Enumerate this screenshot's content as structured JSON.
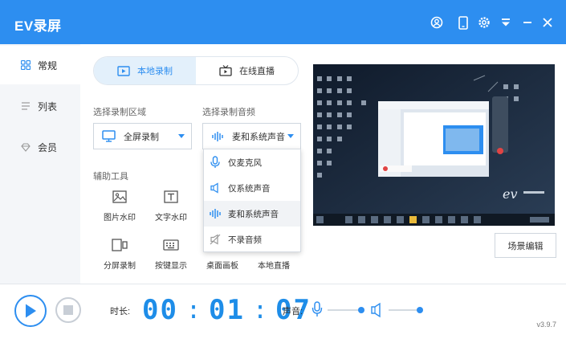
{
  "app": {
    "title": "EV录屏",
    "version": "v3.9.7"
  },
  "titlebar_icons": [
    "user-icon",
    "phone-icon",
    "settings-icon",
    "dropdown-menu-icon",
    "minimize-icon",
    "close-icon"
  ],
  "sidebar": {
    "items": [
      {
        "label": "常规",
        "icon": "grid-icon",
        "active": true
      },
      {
        "label": "列表",
        "icon": "list-icon",
        "active": false
      },
      {
        "label": "会员",
        "icon": "diamond-icon",
        "active": false
      }
    ]
  },
  "tabs": [
    {
      "label": "本地录制",
      "icon": "record-icon",
      "active": true
    },
    {
      "label": "在线直播",
      "icon": "tv-icon",
      "active": false
    }
  ],
  "record_area": {
    "label": "选择录制区域",
    "value": "全屏录制"
  },
  "record_audio": {
    "label": "选择录制音频",
    "value": "麦和系统声音"
  },
  "audio_options": [
    {
      "label": "仅麦克风",
      "icon": "mic-icon"
    },
    {
      "label": "仅系统声音",
      "icon": "speaker-icon"
    },
    {
      "label": "麦和系统声音",
      "icon": "waveform-icon",
      "selected": true
    },
    {
      "label": "不录音频",
      "icon": "mute-icon"
    }
  ],
  "tools": {
    "label": "辅助工具",
    "items": [
      "图片水印",
      "文字水印",
      "分屏录制",
      "按键显示",
      "桌面画板",
      "本地直播"
    ]
  },
  "scene_button": "场景编辑",
  "bottom": {
    "duration_label": "时长:",
    "timer": {
      "h": "00",
      "m": "01",
      "s": "07"
    },
    "volume_label": "声音:"
  },
  "colors": {
    "accent": "#2d8ef0",
    "timer": "#1e8de8"
  }
}
